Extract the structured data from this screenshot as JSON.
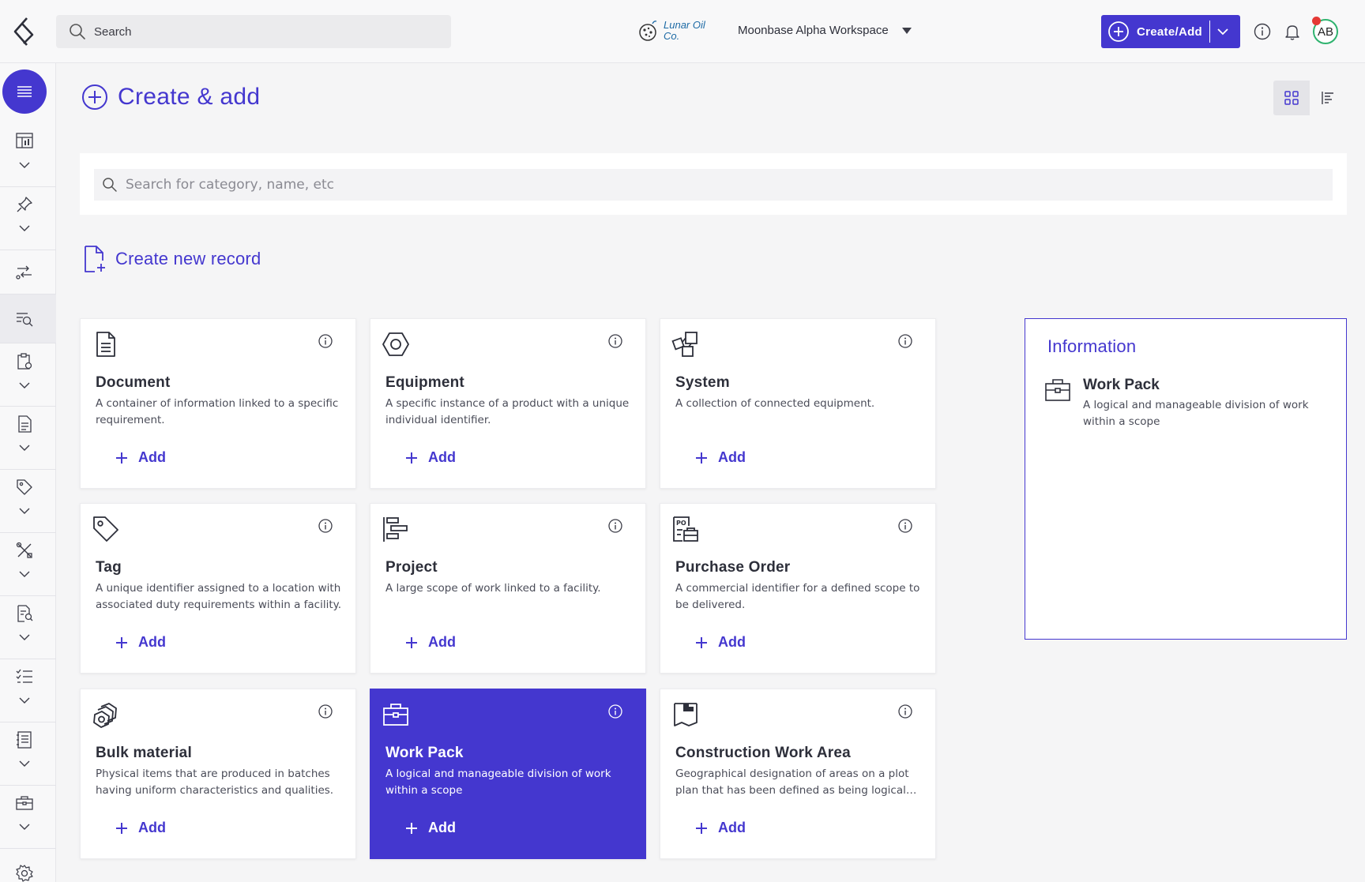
{
  "header": {
    "search_placeholder": "Search",
    "company_name": "Lunar Oil Co.",
    "workspace": "Moonbase Alpha Workspace",
    "create_button": "Create/Add",
    "avatar_initials": "AB"
  },
  "page": {
    "title": "Create & add",
    "search_placeholder": "Search for category, name, etc",
    "section_title": "Create new record",
    "add_label": "Add"
  },
  "cards": [
    {
      "title": "Document",
      "description": "A container of information linked to a specific requirement.",
      "icon": "document-icon"
    },
    {
      "title": "Equipment",
      "description": "A specific instance of a product with a unique individual identifier.",
      "icon": "equipment-icon"
    },
    {
      "title": "System",
      "description": "A collection of connected equipment.",
      "icon": "system-icon"
    },
    {
      "title": "Tag",
      "description": "A unique identifier assigned to a location with associated duty requirements within a facility.",
      "icon": "tag-icon"
    },
    {
      "title": "Project",
      "description": "A large scope of work linked to a facility.",
      "icon": "project-icon"
    },
    {
      "title": "Purchase Order",
      "description": "A commercial identifier for a defined scope to be delivered.",
      "icon": "purchase-order-icon"
    },
    {
      "title": "Bulk material",
      "description": "Physical items that are produced in batches having uniform characteristics and qualities.",
      "icon": "bulk-material-icon"
    },
    {
      "title": "Work Pack",
      "description": "A logical and manageable division of work within a scope",
      "icon": "work-pack-icon",
      "selected": true
    },
    {
      "title": "Construction Work Area",
      "description": "Geographical designation of areas on a plot plan that has been defined as being logical and manageable.",
      "icon": "construction-area-icon"
    }
  ],
  "info_panel": {
    "title": "Information",
    "name": "Work Pack",
    "description": "A logical and manageable division of work within a scope"
  },
  "colors": {
    "accent": "#4437cf",
    "avatar_ring": "#2fb36f",
    "notification_dot": "#e53935"
  }
}
